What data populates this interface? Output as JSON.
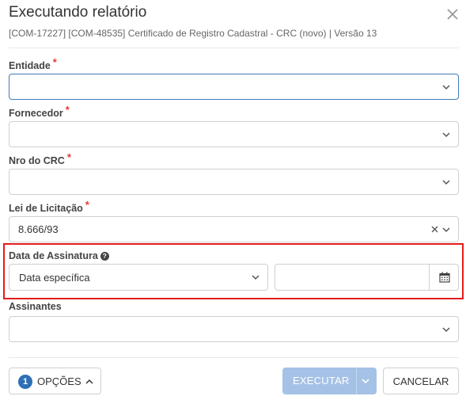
{
  "dialog": {
    "title": "Executando relatório",
    "subtitle": "[COM-17227] [COM-48535] Certificado de Registro Cadastral - CRC (novo) | Versão 13"
  },
  "fields": {
    "entidade": {
      "label": "Entidade",
      "required_mark": "*",
      "value": ""
    },
    "fornecedor": {
      "label": "Fornecedor",
      "required_mark": "*",
      "value": ""
    },
    "nro_crc": {
      "label": "Nro do CRC",
      "required_mark": "*",
      "value": ""
    },
    "lei_licitacao": {
      "label": "Lei de Licitação",
      "required_mark": "*",
      "value": "8.666/93"
    },
    "data_assinatura": {
      "label": "Data de Assinatura",
      "help_glyph": "?",
      "type_value": "Data específica",
      "date_value": ""
    },
    "assinantes": {
      "label": "Assinantes",
      "value": ""
    }
  },
  "footer": {
    "options_count": "1",
    "options_label": "OPÇÕES",
    "execute_label": "EXECUTAR",
    "cancel_label": "CANCELAR"
  },
  "colors": {
    "required": "#e53935",
    "primary": "#2f6fb5",
    "primary_disabled": "#a5c2e6",
    "focus_border": "#3f7cb8",
    "highlight": "#e31b1b"
  },
  "icons": {
    "close": "close-icon",
    "chevron": "chevron-down-icon",
    "clear": "clear-icon",
    "help": "help-circle-icon",
    "calendar": "calendar-icon",
    "chevron_up": "chevron-up-icon"
  }
}
